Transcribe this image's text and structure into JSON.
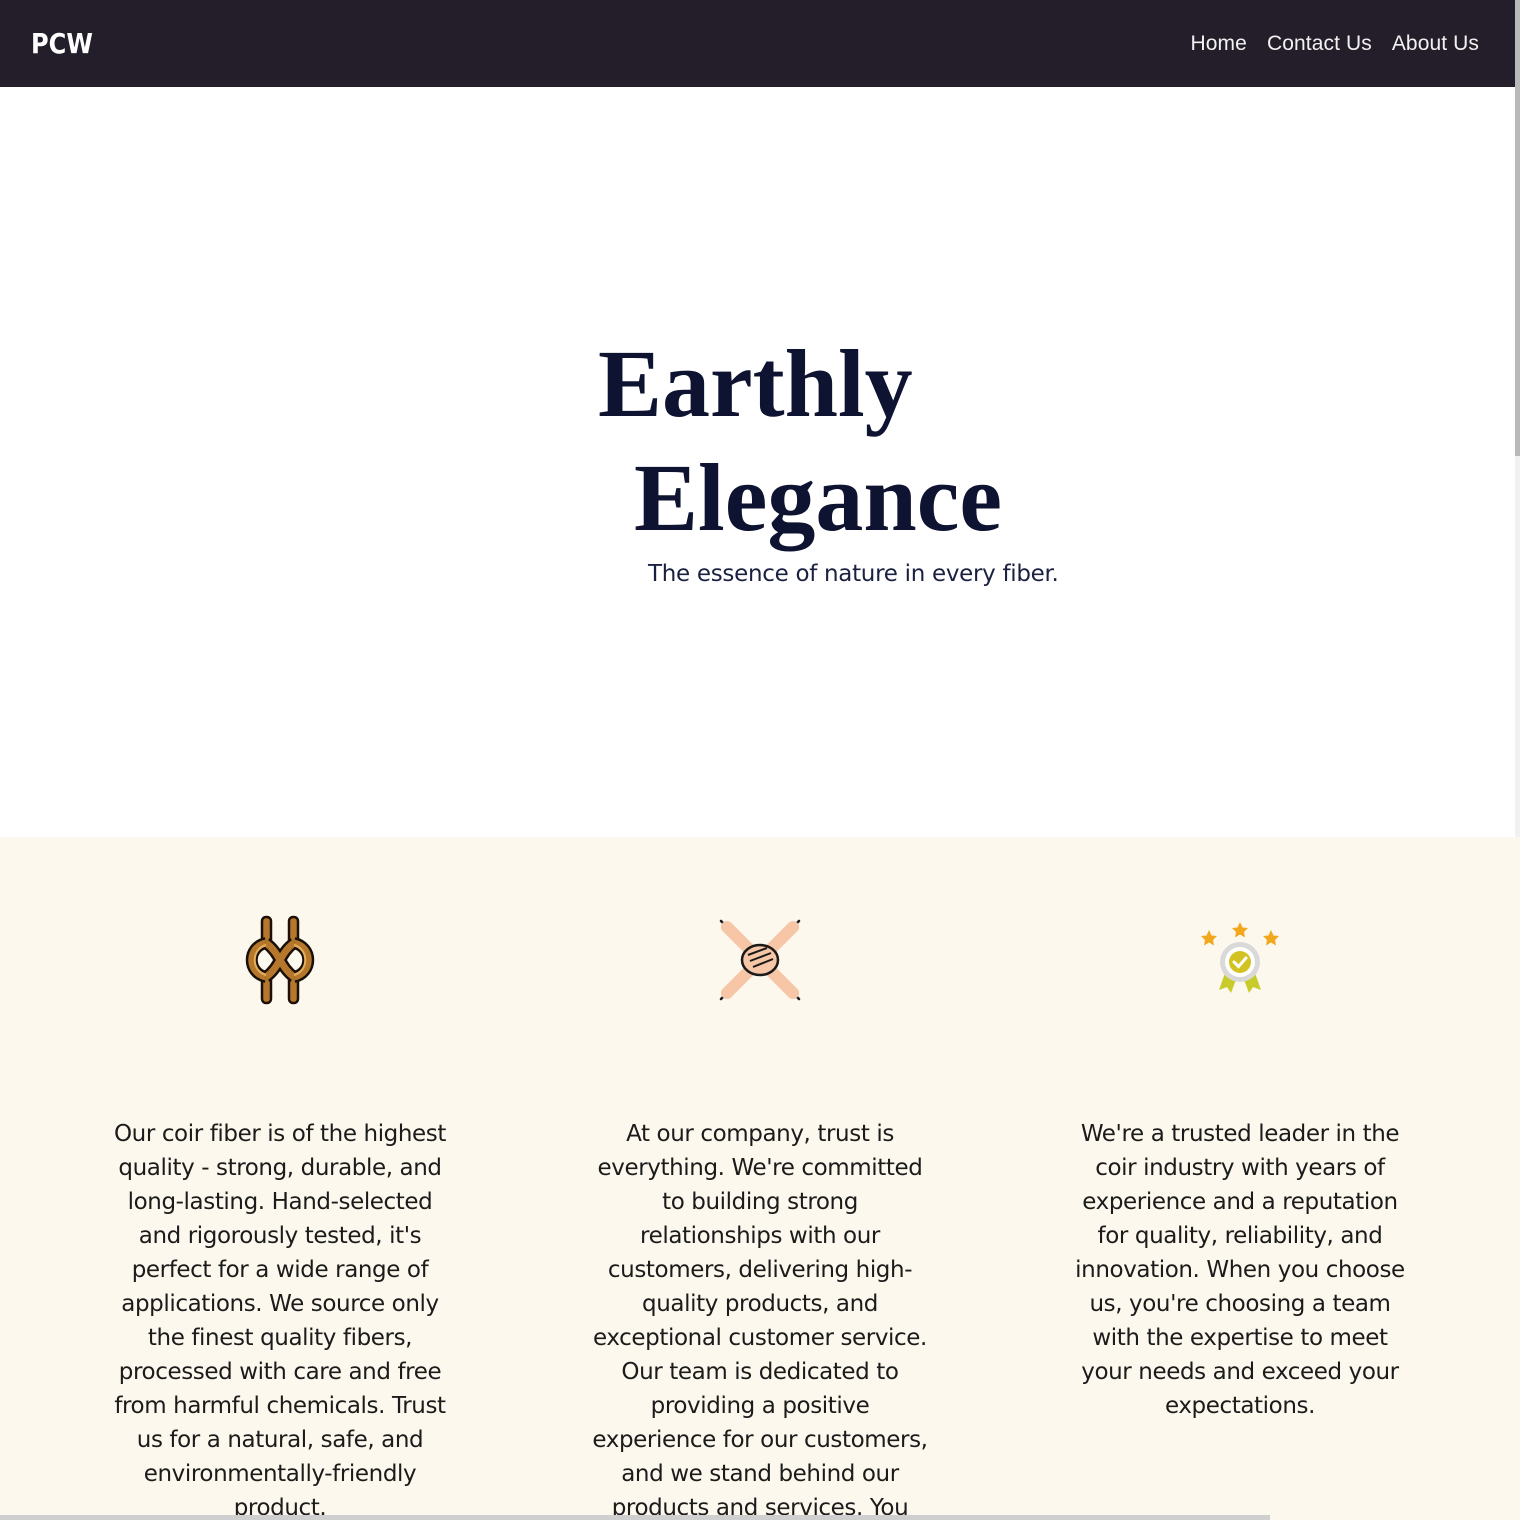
{
  "header": {
    "brand": "PCW",
    "nav": [
      "Home",
      "Contact Us",
      "About Us"
    ]
  },
  "hero": {
    "title_line1": "Earthly",
    "title_line2": "Elegance",
    "subtitle": "The essence of nature in every fiber."
  },
  "features": [
    {
      "icon": "rope-knot-icon",
      "text": "Our coir fiber is of the highest quality - strong, durable, and long-lasting. Hand-selected and rigorously tested, it's perfect for a wide range of applications. We source only the finest quality fibers, processed with care and free from harmful chemicals. Trust us for a natural, safe, and environmentally-friendly product."
    },
    {
      "icon": "stacked-hands-icon",
      "text": "At our company, trust is everything. We're committed to building strong relationships with our customers, delivering high-quality products, and exceptional customer service. Our team is dedicated to providing a positive experience for our customers, and we stand behind our products and services. You"
    },
    {
      "icon": "award-badge-icon",
      "text": "We're a trusted leader in the coir industry with years of experience and a reputation for quality, reliability, and innovation. When you choose us, you're choosing a team with the expertise to meet your needs and exceed your expectations."
    }
  ],
  "colors": {
    "navbar_bg": "#231e2a",
    "title": "#0d1330",
    "features_bg": "#fdf8ed"
  }
}
